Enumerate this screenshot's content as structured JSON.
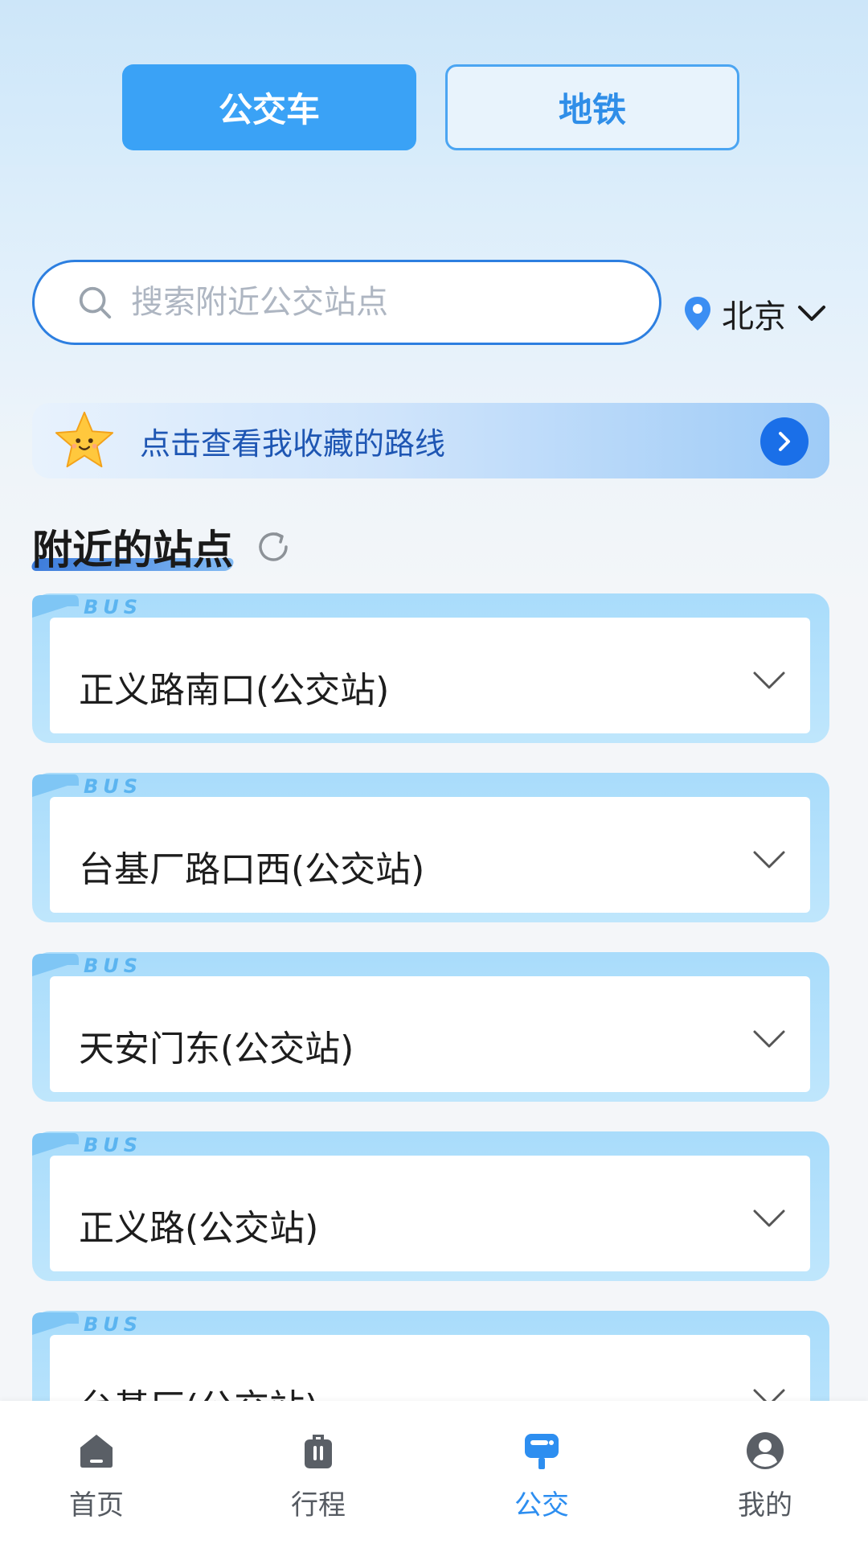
{
  "tabs": [
    {
      "label": "公交车",
      "active": true
    },
    {
      "label": "地铁",
      "active": false
    }
  ],
  "search": {
    "placeholder": "搜索附近公交站点",
    "value": ""
  },
  "city": {
    "name": "北京"
  },
  "favorites": {
    "text": "点击查看我收藏的路线"
  },
  "nearby": {
    "title": "附近的站点"
  },
  "card_tag": "BUS",
  "stations": [
    {
      "name": "正义路南口(公交站)"
    },
    {
      "name": "台基厂路口西(公交站)"
    },
    {
      "name": "天安门东(公交站)"
    },
    {
      "name": "正义路(公交站)"
    },
    {
      "name": "台基厂(公交站)"
    }
  ],
  "nav": [
    {
      "label": "首页",
      "icon": "home-icon",
      "active": false
    },
    {
      "label": "行程",
      "icon": "luggage-icon",
      "active": false
    },
    {
      "label": "公交",
      "icon": "bus-icon",
      "active": true
    },
    {
      "label": "我的",
      "icon": "profile-icon",
      "active": false
    }
  ],
  "colors": {
    "accent": "#3aa2f6",
    "link": "#2d8ef0",
    "banner_text": "#1e56b3"
  }
}
